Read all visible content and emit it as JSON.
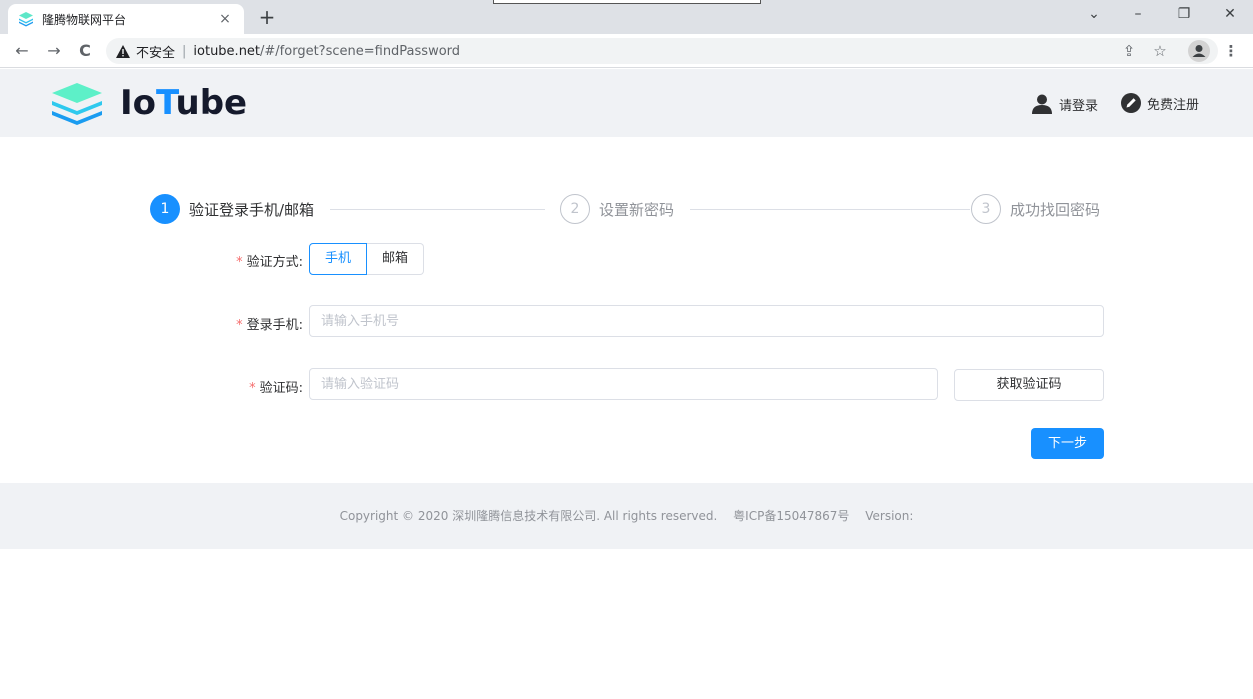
{
  "browser": {
    "tab_title": "隆腾物联网平台",
    "tab_close": "×",
    "new_tab": "+",
    "window_controls": [
      "⌄",
      "–",
      "❐",
      "✕"
    ],
    "nav": {
      "back": "←",
      "forward": "→",
      "reload": "C"
    },
    "url": {
      "insecure_label": "不安全",
      "separator": "|",
      "host": "iotube.net",
      "path": "/#/forget?scene=findPassword"
    },
    "right_icons": [
      "⇪",
      "☆",
      "⋮"
    ]
  },
  "header": {
    "logo_prefix": "Io",
    "logo_accent": "T",
    "logo_suffix": "ube",
    "login_label": "请登录",
    "register_label": "免费注册"
  },
  "steps": [
    {
      "num": "1",
      "label": "验证登录手机/邮箱",
      "state": "active"
    },
    {
      "num": "2",
      "label": "设置新密码",
      "state": "wait"
    },
    {
      "num": "3",
      "label": "成功找回密码",
      "state": "wait"
    }
  ],
  "form": {
    "method": {
      "required_mark": "*",
      "label": "验证方式:",
      "options": [
        "手机",
        "邮箱"
      ],
      "selected": "手机"
    },
    "phone": {
      "required_mark": "*",
      "label": "登录手机:",
      "value": "",
      "placeholder": "请输入手机号"
    },
    "code": {
      "required_mark": "*",
      "label": "验证码:",
      "value": "",
      "placeholder": "请输入验证码",
      "button_label": "获取验证码"
    },
    "next_label": "下一步"
  },
  "footer": {
    "copyright": "Copyright © 2020 深圳隆腾信息技术有限公司. All rights reserved.",
    "icp": "粤ICP备15047867号",
    "version": "Version:"
  },
  "colors": {
    "primary": "#1890ff",
    "required": "#f56c6c",
    "header_bg": "#f0f2f5"
  }
}
